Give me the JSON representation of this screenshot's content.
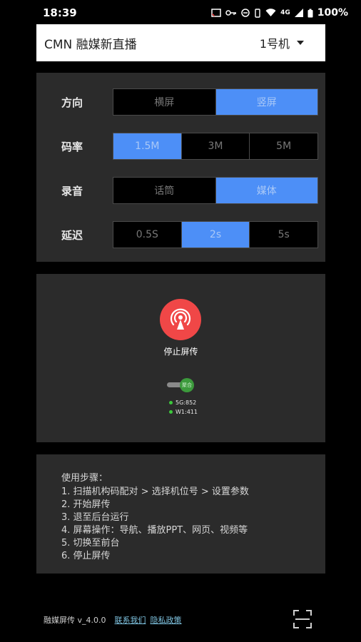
{
  "status_bar": {
    "time": "18:39",
    "network_type": "4G",
    "battery": "100%"
  },
  "header": {
    "title": "CMN 融媒新直播",
    "device": "1号机"
  },
  "settings": [
    {
      "label": "方向",
      "options": [
        "横屏",
        "竖屏"
      ],
      "selected": 1
    },
    {
      "label": "码率",
      "options": [
        "1.5M",
        "3M",
        "5M"
      ],
      "selected": 0
    },
    {
      "label": "录音",
      "options": [
        "话筒",
        "媒体"
      ],
      "selected": 1
    },
    {
      "label": "延迟",
      "options": [
        "0.5S",
        "2s",
        "5s"
      ],
      "selected": 1
    }
  ],
  "cast": {
    "button_label": "停止屏传",
    "toggle_label": "聚合",
    "net_5g": "5G:852",
    "net_wifi": "W1:411"
  },
  "steps": {
    "title": "使用步骤：",
    "items": [
      "1. 扫描机构码配对 > 选择机位号 > 设置参数",
      "2. 开始屏传",
      "3. 退至后台运行",
      "4. 屏幕操作：导航、播放PPT、网页、视频等",
      "5. 切换至前台",
      "6. 停止屏传"
    ]
  },
  "footer": {
    "app_version": "融媒屏传 v_4.0.0",
    "contact_link": "联系我们",
    "privacy_link": "隐私政策"
  },
  "colors": {
    "accent": "#4d8ff7",
    "record": "#f04747",
    "panel": "#2b2b2b",
    "toggle_on": "#3c9a3c"
  }
}
